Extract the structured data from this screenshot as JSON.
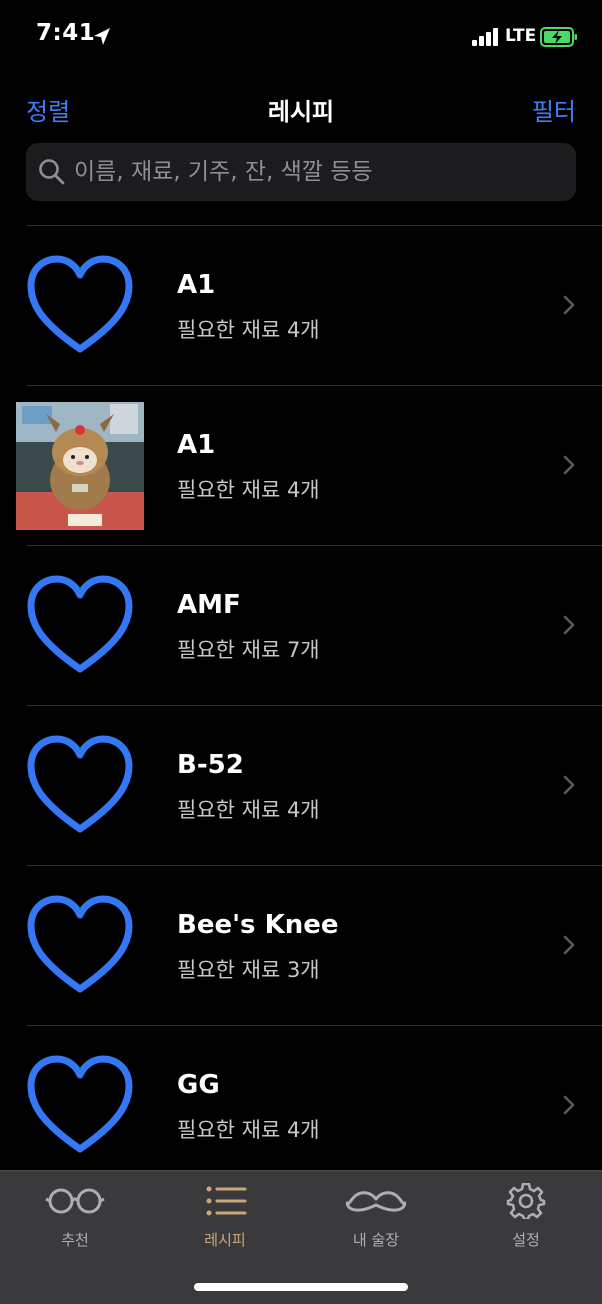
{
  "status": {
    "time": "7:41",
    "network": "LTE"
  },
  "nav": {
    "sort": "정렬",
    "title": "레시피",
    "filter": "필터"
  },
  "search": {
    "placeholder": "이름, 재료, 기주, 잔, 색깔 등등",
    "value": ""
  },
  "recipes": [
    {
      "name": "A1",
      "subtitle": "필요한 재료 4개",
      "thumbnail": "heart-outline-icon"
    },
    {
      "name": "A1",
      "subtitle": "필요한 재료 4개",
      "thumbnail": "photo"
    },
    {
      "name": "AMF",
      "subtitle": "필요한 재료 7개",
      "thumbnail": "heart-outline-icon"
    },
    {
      "name": "B-52",
      "subtitle": "필요한 재료 4개",
      "thumbnail": "heart-outline-icon"
    },
    {
      "name": "Bee's Knee",
      "subtitle": "필요한 재료 3개",
      "thumbnail": "heart-outline-icon"
    },
    {
      "name": "GG",
      "subtitle": "필요한 재료 4개",
      "thumbnail": "heart-outline-icon"
    }
  ],
  "tabs": [
    {
      "label": "추천",
      "icon": "glasses-icon",
      "active": false
    },
    {
      "label": "레시피",
      "icon": "list-icon",
      "active": true
    },
    {
      "label": "내 술장",
      "icon": "mustache-icon",
      "active": false
    },
    {
      "label": "설정",
      "icon": "gear-icon",
      "active": false
    }
  ],
  "colors": {
    "accent": "#3d7ff5",
    "heart": "#3478f6",
    "active_tab": "#c9a779",
    "battery": "#4cd964"
  }
}
